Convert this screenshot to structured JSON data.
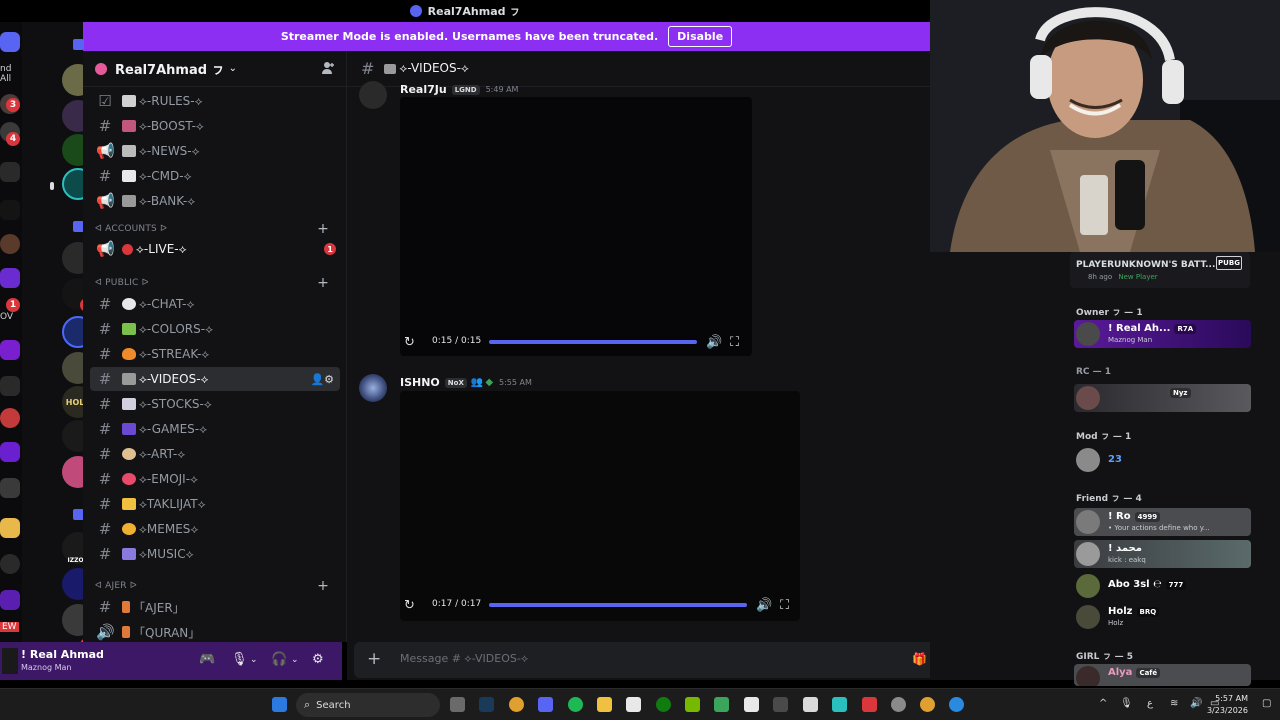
{
  "window": {
    "title": "Real7Ahmad ㇷ"
  },
  "streamer_banner": {
    "text": "Streamer Mode is enabled. Usernames have been truncated.",
    "button": "Disable"
  },
  "edge": {
    "label_all": "nd All",
    "label_ov": "OV",
    "label_new": "EW",
    "badges": [
      "3",
      "4",
      "1"
    ]
  },
  "servers": {
    "badges": [
      "1",
      "1"
    ],
    "holz_label": "HOLZ",
    "izzou_label": "IZZOU"
  },
  "guild": {
    "name": "Real7Ahmad ㇷ",
    "chevron": "⌄"
  },
  "categories": {
    "accounts": "ᐊ ACCOUNTS ᐅ",
    "public": "ᐊ PUBLIC ᐅ",
    "ajer": "ᐊ AJER ᐅ"
  },
  "channels": [
    {
      "name": "⟡-RULES-⟡",
      "icon": "checkbox"
    },
    {
      "name": "⟡-BOOST-⟡",
      "icon": "hash"
    },
    {
      "name": "⟡-NEWS-⟡",
      "icon": "megaphone"
    },
    {
      "name": "⟡-CMD-⟡",
      "icon": "hash"
    },
    {
      "name": "⟡-BANK-⟡",
      "icon": "megaphone"
    },
    {
      "name": "⟡-LIVE-⟡",
      "icon": "megaphone",
      "badge": "1"
    },
    {
      "name": "⟡-CHAT-⟡",
      "icon": "hash"
    },
    {
      "name": "⟡-COLORS-⟡",
      "icon": "hash"
    },
    {
      "name": "⟡-STREAK-⟡",
      "icon": "hash"
    },
    {
      "name": "⟡-VIDEOS-⟡",
      "icon": "hash",
      "active": true
    },
    {
      "name": "⟡-STOCKS-⟡",
      "icon": "hash"
    },
    {
      "name": "⟡-GAMES-⟡",
      "icon": "hash"
    },
    {
      "name": "⟡-ART-⟡",
      "icon": "hash"
    },
    {
      "name": "⟡-EMOJI-⟡",
      "icon": "hash"
    },
    {
      "name": "⟡TAKLIJAT⟡",
      "icon": "hash"
    },
    {
      "name": "⟡MEMES⟡",
      "icon": "hash"
    },
    {
      "name": "⟡MUSIC⟡",
      "icon": "hash"
    },
    {
      "name": "「AJER」",
      "icon": "hash"
    },
    {
      "name": "「QURAN」",
      "icon": "speaker"
    }
  ],
  "user_panel": {
    "name": "! Real Ahmad",
    "status": "Maznog Man"
  },
  "chat": {
    "channel_name": "⟡-VIDEOS-⟡",
    "messages": [
      {
        "author": "Real7Ju",
        "tag": "LGND",
        "time": "5:49 AM",
        "video_time": "0:15 / 0:15"
      },
      {
        "author": "ISHNO",
        "tag": "NoX",
        "time": "5:55 AM",
        "video_time": "0:17 / 0:17"
      }
    ]
  },
  "composer": {
    "placeholder": "Message # ⟡-VIDEOS-⟡"
  },
  "activity": {
    "title": "PLAYERUNKNOWN'S BATT...",
    "subtitle": "8h ago",
    "sub2": "New Player",
    "logo": "PUBG"
  },
  "members": {
    "roles": [
      "Owner ㇷ — 1",
      "RC — 1",
      "Mod ㇷ — 1",
      "Friend ㇷ — 4",
      "GIRL ㇷ — 5"
    ],
    "list": [
      {
        "name": "! Real Ah...",
        "tag": "R7A",
        "sub": "Maznog Man",
        "bg": "#4a1a7a"
      },
      {
        "name": "",
        "tag": "Nyz",
        "sub": "",
        "bg": "#3a3a3e"
      },
      {
        "name": "23",
        "tag": "",
        "sub": "",
        "bg": "transparent"
      },
      {
        "name": "! Ro",
        "tag": "4999",
        "sub": "• Your actions define who y...",
        "bg": "#3f4145"
      },
      {
        "name": "! محمد",
        "tag": "",
        "sub": "kick : eakq",
        "bg": "#3f4145"
      },
      {
        "name": "Abo 3sl ℮",
        "tag": "777",
        "sub": "",
        "bg": "transparent"
      },
      {
        "name": "Holz",
        "tag": "BRQ",
        "sub": "Holz",
        "bg": "transparent"
      },
      {
        "name": "Alya",
        "tag": "Café",
        "sub": "",
        "bg": "#3f4145"
      }
    ]
  },
  "taskbar": {
    "search": "Search",
    "time": "5:57 AM",
    "date": "3/23/2026",
    "lang": "ع"
  },
  "colors": {
    "discord_blurple": "#5865f2",
    "banner_purple": "#8d2ff2",
    "panel_purple": "#3d1866",
    "bg": "#121214",
    "danger": "#da373c"
  }
}
